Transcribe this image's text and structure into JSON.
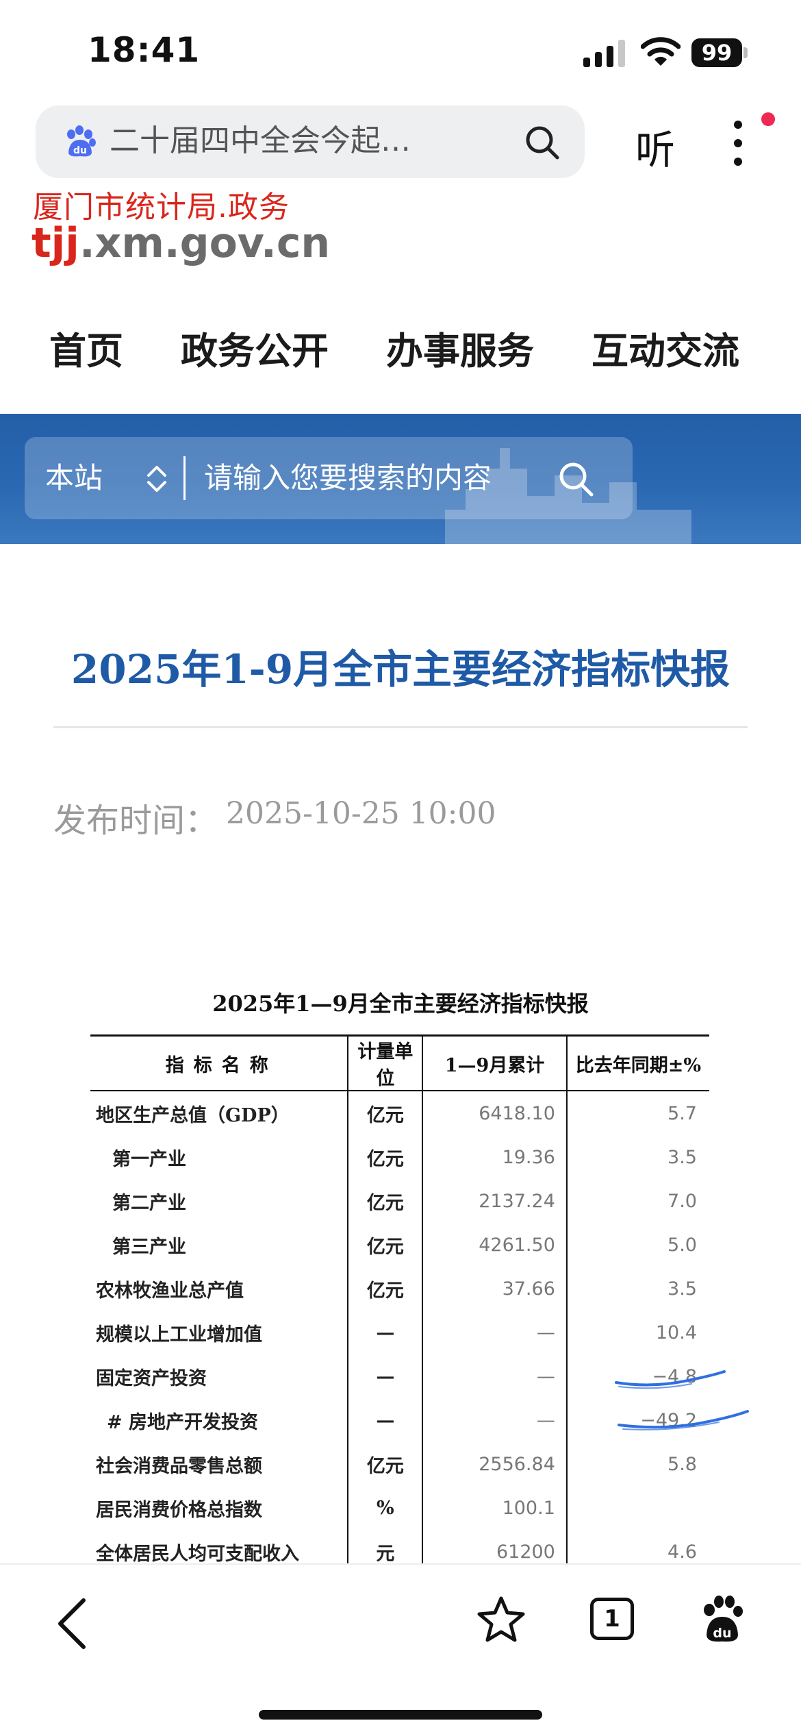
{
  "status_bar": {
    "time": "18:41",
    "battery": "99"
  },
  "browser": {
    "query": "二十届四中全会今起…",
    "listen_label": "听"
  },
  "site_logo": {
    "cn": "厦门市统计局.政务",
    "url_prefix": "tjj",
    "url_rest": ".xm.gov.cn"
  },
  "nav": [
    "首页",
    "政务公开",
    "办事服务",
    "互动交流"
  ],
  "site_search": {
    "scope": "本站",
    "placeholder": "请输入您要搜索的内容"
  },
  "article": {
    "title": "2025年1-9月全市主要经济指标快报",
    "publish_label": "发布时间：",
    "publish_time": "2025-10-25 10:00"
  },
  "table": {
    "caption": "2025年1—9月全市主要经济指标快报",
    "headers": [
      "指标名称",
      "计量单位",
      "1—9月累计",
      "比去年同期±%"
    ],
    "rows": [
      [
        "地区生产总值（GDP）",
        "亿元",
        "6418.10",
        "5.7"
      ],
      [
        "第一产业",
        "亿元",
        "19.36",
        "3.5"
      ],
      [
        "第二产业",
        "亿元",
        "2137.24",
        "7.0"
      ],
      [
        "第三产业",
        "亿元",
        "4261.50",
        "5.0"
      ],
      [
        "农林牧渔业总产值",
        "亿元",
        "37.66",
        "3.5"
      ],
      [
        "规模以上工业增加值",
        "—",
        "—",
        "10.4"
      ],
      [
        "固定资产投资",
        "—",
        "—",
        "−4.8"
      ],
      [
        "# 房地产开发投资",
        "—",
        "—",
        "−49.2"
      ],
      [
        "社会消费品零售总额",
        "亿元",
        "2556.84",
        "5.8"
      ],
      [
        "居民消费价格总指数",
        "%",
        "100.1",
        ""
      ],
      [
        "全体居民人均可支配收入",
        "元",
        "61200",
        "4.6"
      ],
      [
        "",
        "",
        "",
        ""
      ]
    ]
  },
  "toolbar": {
    "tab_count": "1"
  },
  "colors": {
    "accent_blue": "#1f5aa6",
    "band_blue": "#2a68b3",
    "logo_red": "#d9261c",
    "notify_red": "#ef2a52",
    "pen_blue": "#2f6fe0"
  }
}
